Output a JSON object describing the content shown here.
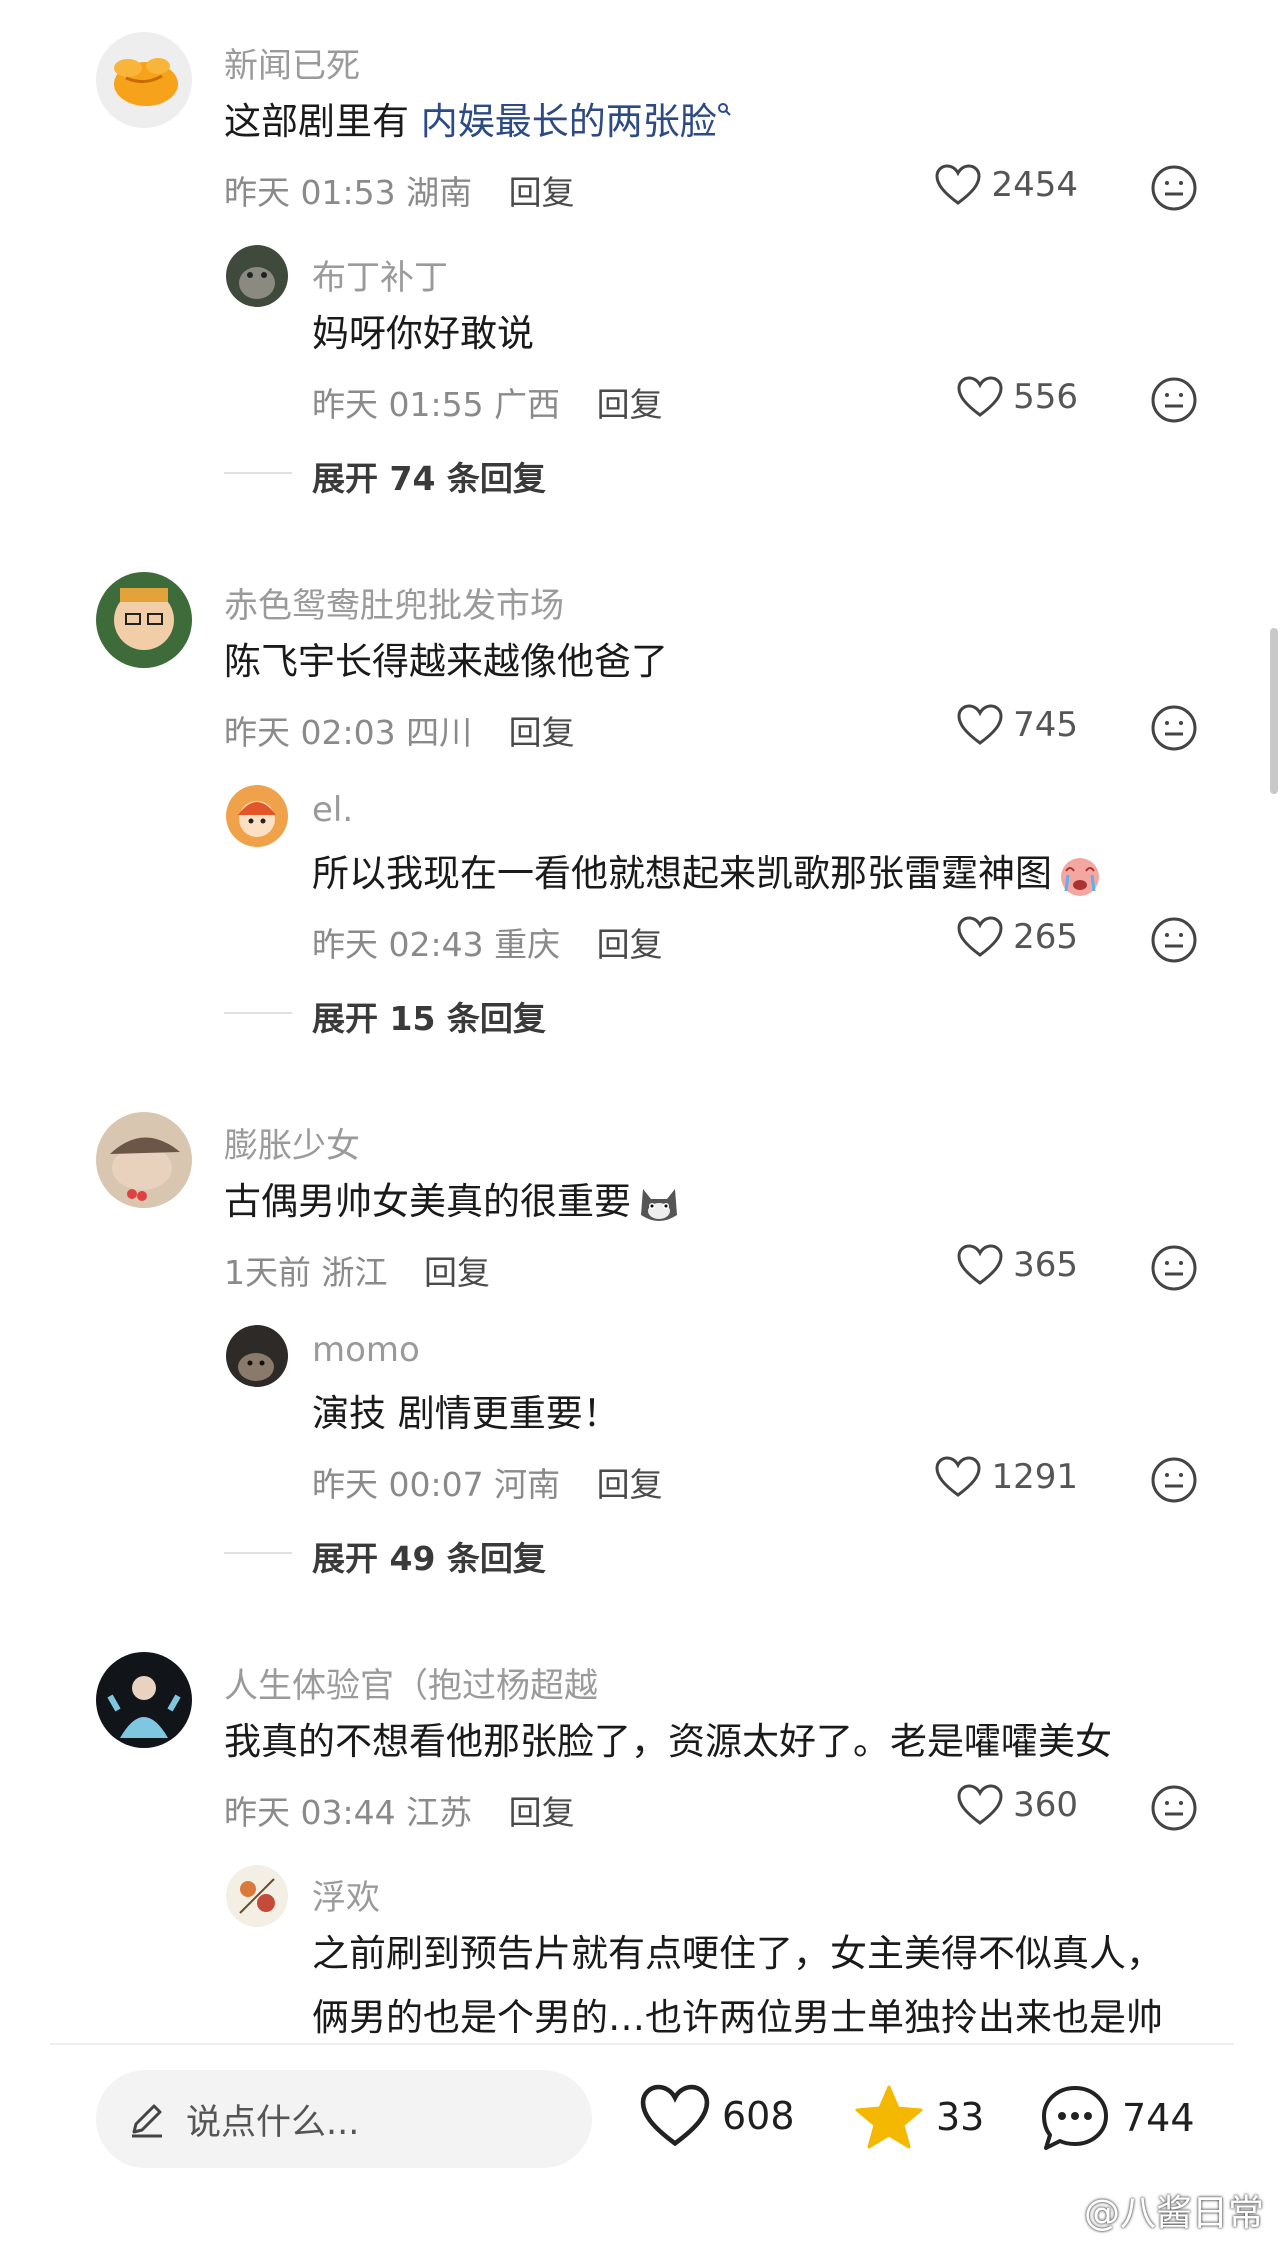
{
  "threads": [
    {
      "main": {
        "user": "新闻已死",
        "text_plain": "这部剧里有 ",
        "text_link": "内娱最长的两张脸",
        "time": "昨天 01:53",
        "loc": "湖南",
        "reply": "回复",
        "likes": "2454"
      },
      "sub": {
        "user": "布丁补丁",
        "text": "妈呀你好敢说",
        "time": "昨天 01:55",
        "loc": "广西",
        "reply": "回复",
        "likes": "556"
      },
      "expand": "展开 74 条回复"
    },
    {
      "main": {
        "user": "赤色鸳鸯肚兜批发市场",
        "text": "陈飞宇长得越来越像他爸了",
        "time": "昨天 02:03",
        "loc": "四川",
        "reply": "回复",
        "likes": "745"
      },
      "sub": {
        "user": "el.",
        "text": "所以我现在一看他就想起来凯歌那张雷霆神图",
        "time": "昨天 02:43",
        "loc": "重庆",
        "reply": "回复",
        "likes": "265"
      },
      "expand": "展开 15 条回复"
    },
    {
      "main": {
        "user": "膨胀少女",
        "text": "古偶男帅女美真的很重要",
        "time": "1天前",
        "loc": "浙江",
        "reply": "回复",
        "likes": "365"
      },
      "sub": {
        "user": "momo",
        "text": "演技  剧情更重要！",
        "time": "昨天 00:07",
        "loc": "河南",
        "reply": "回复",
        "likes": "1291"
      },
      "expand": "展开 49 条回复"
    },
    {
      "main": {
        "user": "人生体验官（抱过杨超越",
        "text": "我真的不想看他那张脸了，资源太好了。老是嚯嚯美女",
        "time": "昨天 03:44",
        "loc": "江苏",
        "reply": "回复",
        "likes": "360"
      },
      "sub": {
        "user": "浮欢",
        "text_line1": "之前刷到预告片就有点哽住了，女主美得不似真人，",
        "text_line2": "俩男的也是个男的…也许两位男士单独拎出来也是帅"
      }
    }
  ],
  "bottom_bar": {
    "input_placeholder": "说点什么...",
    "likes": "608",
    "favorites": "33",
    "comments": "744"
  },
  "watermark": "@八酱日常",
  "colors": {
    "link": "#2c4a86",
    "star": "#f5b800",
    "gray_text": "#9a9a9a"
  }
}
